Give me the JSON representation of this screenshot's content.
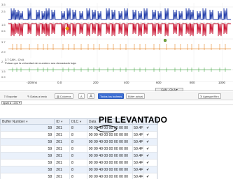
{
  "scope": {
    "channels": [
      {
        "label": "3.5",
        "color": "#1f3aa8"
      },
      {
        "label": "1.5",
        "color": "#c8102e"
      },
      {
        "label": "3.7",
        "color": "#e07000"
      },
      {
        "label": "2.7",
        "color": "#2a9a2a"
      }
    ],
    "y_labels": [
      "3.5",
      "2.5",
      "1.5",
      "0.5",
      "3.7",
      "2.9",
      "2.7",
      "1.5",
      "0.9"
    ],
    "annotation_title": "3.7 CAN - Ch A",
    "annotation_text": "Pulsar que la velocidad de muestreo sea demasiado baja",
    "x_ticks": [
      "-200ms",
      "0.0",
      "200",
      "400",
      "600",
      "800",
      "1000"
    ],
    "cursor_tab": "CAN - Ch A ▾"
  },
  "toolbar": {
    "exportar": "Exportar",
    "datos_a_texto": "Datos a texto",
    "columnas": "Columns",
    "font_down": "A",
    "font_up": "A",
    "todos_los_bufferes": "Todos los buferes",
    "bufer_actual": "Búfer actual",
    "agregar_filtro": "Agregar filtro"
  },
  "filter": {
    "selected": "Igual a : 201 ▾"
  },
  "overlay_text": "PIE LEVANTADO",
  "table": {
    "headers": [
      "Buffer Number",
      "ID",
      "DLC",
      "Data",
      "",
      ""
    ],
    "rows": [
      {
        "buffer": "59",
        "id": "201",
        "dlc": "8",
        "data": "00 00 40 00 00 00 00 00",
        "temp": "50.4F",
        "ok": "✔"
      },
      {
        "buffer": "59",
        "id": "201",
        "dlc": "8",
        "data": "00 00 40 00 00 00 00 00",
        "temp": "50.4F",
        "ok": "✔"
      },
      {
        "buffer": "59",
        "id": "201",
        "dlc": "8",
        "data": "00 00 40 00 00 00 00 00",
        "temp": "50.4F",
        "ok": "✔"
      },
      {
        "buffer": "59",
        "id": "201",
        "dlc": "8",
        "data": "00 00 40 00 00 00 00 00",
        "temp": "50.4F",
        "ok": "✔"
      },
      {
        "buffer": "59",
        "id": "201",
        "dlc": "8",
        "data": "00 00 40 00 00 00 00 00",
        "temp": "50.4F",
        "ok": "✔"
      },
      {
        "buffer": "59",
        "id": "201",
        "dlc": "8",
        "data": "00 00 40 00 00 00 00 00",
        "temp": "50.4F",
        "ok": "✔"
      },
      {
        "buffer": "58",
        "id": "201",
        "dlc": "8",
        "data": "00 00 40 00 00 00 00 00",
        "temp": "50.4F",
        "ok": "✔"
      },
      {
        "buffer": "58",
        "id": "201",
        "dlc": "8",
        "data": "00 00 40 00 00 00 00 00",
        "temp": "50.4F",
        "ok": "✔"
      }
    ]
  }
}
